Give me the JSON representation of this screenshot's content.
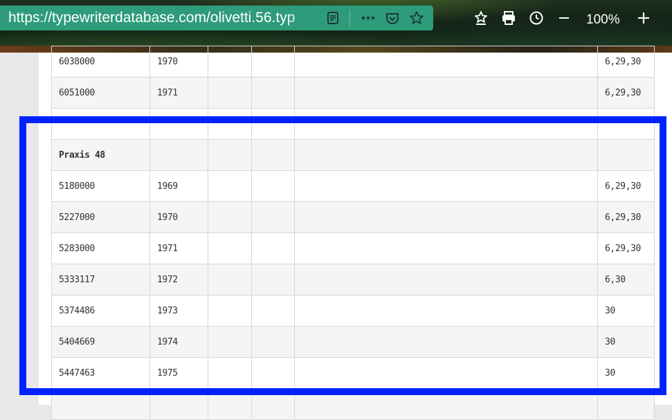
{
  "browser": {
    "url": "https://typewriterdatabase.com/olivetti.56.typ",
    "zoom": "100%",
    "icons": [
      "reader-view-icon",
      "more-icon",
      "pocket-icon",
      "bookmark-star-icon",
      "bookmarks-manager-icon",
      "print-icon",
      "history-clock-icon",
      "zoom-out-icon",
      "zoom-in-icon"
    ]
  },
  "table": {
    "rows": [
      {
        "serial": "6038000",
        "year": "1970",
        "c3": "",
        "c4": "",
        "c5": "",
        "sources": "6,29,30",
        "alt": false,
        "model": false
      },
      {
        "serial": "6051000",
        "year": "1971",
        "c3": "",
        "c4": "",
        "c5": "",
        "sources": "6,29,30",
        "alt": true,
        "model": false
      },
      {
        "serial": "",
        "year": "",
        "c3": "",
        "c4": "",
        "c5": "",
        "sources": "",
        "alt": false,
        "model": false
      },
      {
        "serial": "Praxis 48",
        "year": "",
        "c3": "",
        "c4": "",
        "c5": "",
        "sources": "",
        "alt": true,
        "model": true
      },
      {
        "serial": "5180000",
        "year": "1969",
        "c3": "",
        "c4": "",
        "c5": "",
        "sources": "6,29,30",
        "alt": false,
        "model": false
      },
      {
        "serial": "5227000",
        "year": "1970",
        "c3": "",
        "c4": "",
        "c5": "",
        "sources": "6,29,30",
        "alt": true,
        "model": false
      },
      {
        "serial": "5283000",
        "year": "1971",
        "c3": "",
        "c4": "",
        "c5": "",
        "sources": "6,29,30",
        "alt": false,
        "model": false
      },
      {
        "serial": "5333117",
        "year": "1972",
        "c3": "",
        "c4": "",
        "c5": "",
        "sources": "6,30",
        "alt": true,
        "model": false
      },
      {
        "serial": "5374486",
        "year": "1973",
        "c3": "",
        "c4": "",
        "c5": "",
        "sources": "30",
        "alt": false,
        "model": false
      },
      {
        "serial": "5404669",
        "year": "1974",
        "c3": "",
        "c4": "",
        "c5": "",
        "sources": "30",
        "alt": true,
        "model": false
      },
      {
        "serial": "5447463",
        "year": "1975",
        "c3": "",
        "c4": "",
        "c5": "",
        "sources": "30",
        "alt": false,
        "model": false
      },
      {
        "serial": "",
        "year": "",
        "c3": "",
        "c4": "",
        "c5": "",
        "sources": "",
        "alt": true,
        "model": false
      }
    ]
  },
  "colors": {
    "highlight": "#0022ff",
    "urlbar": "#2e9b7a"
  }
}
